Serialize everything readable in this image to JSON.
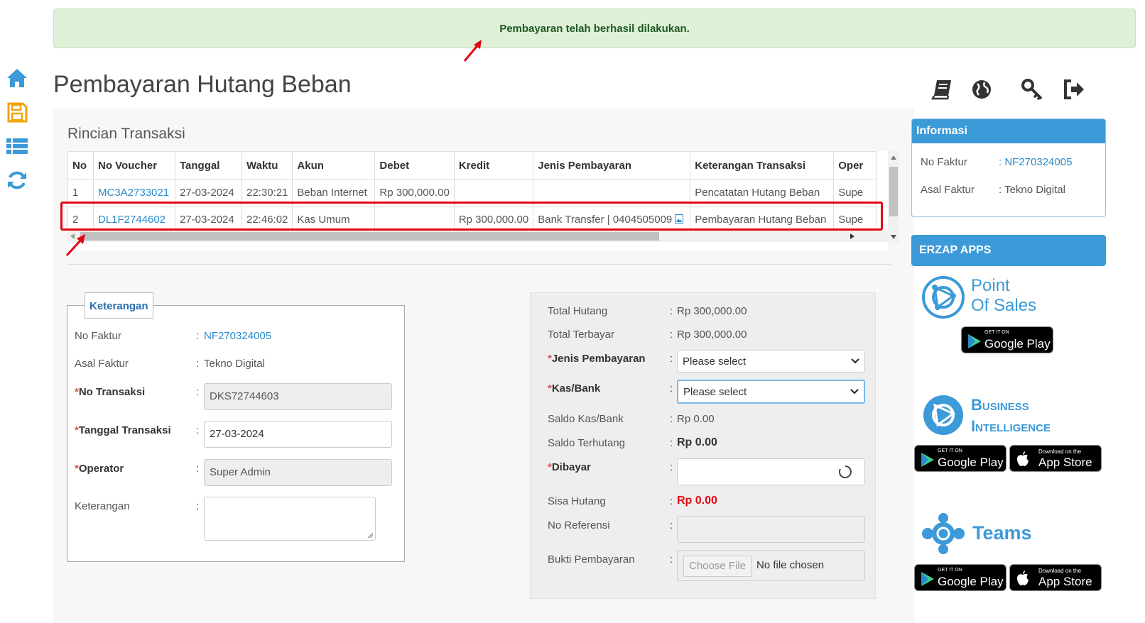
{
  "alert": {
    "message": "Pembayaran telah berhasil dilakukan."
  },
  "page": {
    "title": "Pembayaran Hutang Beban"
  },
  "section": {
    "title": "Rincian Transaksi"
  },
  "table": {
    "headers": [
      "No",
      "No Voucher",
      "Tanggal",
      "Waktu",
      "Akun",
      "Debet",
      "Kredit",
      "Jenis Pembayaran",
      "Keterangan Transaksi",
      "Oper"
    ],
    "rows": [
      {
        "no": "1",
        "voucher": "MC3A2733021",
        "tanggal": "27-03-2024",
        "waktu": "22:30:21",
        "akun": "Beban Internet",
        "debet": "Rp 300,000.00",
        "kredit": "",
        "jenis": "",
        "keterangan": "Pencatatan Hutang Beban",
        "operator": "Supe"
      },
      {
        "no": "2",
        "voucher": "DL1F2744602",
        "tanggal": "27-03-2024",
        "waktu": "22:46:02",
        "akun": "Kas Umum",
        "debet": "",
        "kredit": "Rp 300,000.00",
        "jenis": "Bank Transfer | 0404505009",
        "keterangan": "Pembayaran Hutang Beban",
        "operator": "Supe"
      }
    ]
  },
  "keterangan": {
    "legend": "Keterangan",
    "no_faktur_label": "No Faktur",
    "no_faktur_value": "NF270324005",
    "asal_faktur_label": "Asal Faktur",
    "asal_faktur_value": "Tekno Digital",
    "no_transaksi_label": "No Transaksi",
    "no_transaksi_value": "DKS72744603",
    "tanggal_label": "Tanggal Transaksi",
    "tanggal_value": "27-03-2024",
    "operator_label": "Operator",
    "operator_value": "Super Admin",
    "keterangan_label": "Keterangan",
    "colon": ":",
    "asterisk": "*"
  },
  "payment": {
    "total_hutang_label": "Total Hutang",
    "total_hutang_value": "Rp 300,000.00",
    "total_terbayar_label": "Total Terbayar",
    "total_terbayar_value": "Rp 300,000.00",
    "jenis_label": "Jenis Pembayaran",
    "jenis_value": "Please select",
    "kasbank_label": "Kas/Bank",
    "kasbank_value": "Please select",
    "saldo_kas_label": "Saldo Kas/Bank",
    "saldo_kas_value": "Rp 0.00",
    "saldo_terhutang_label": "Saldo Terhutang",
    "saldo_terhutang_value": "Rp 0.00",
    "dibayar_label": "Dibayar",
    "sisa_label": "Sisa Hutang",
    "sisa_value": "Rp 0.00",
    "no_ref_label": "No Referensi",
    "bukti_label": "Bukti Pembayaran",
    "choose_file": "Choose File",
    "no_file": "No file chosen",
    "colon": ":",
    "asterisk": "*"
  },
  "informasi": {
    "title": "Informasi",
    "no_faktur_label": "No Faktur",
    "no_faktur_value": ": NF270324005",
    "asal_faktur_label": "Asal Faktur",
    "asal_faktur_value": ": Tekno Digital"
  },
  "apps": {
    "title": "ERZAP APPS",
    "pos_line1": "Point",
    "pos_line2": "Of Sales",
    "bi_line1": "Business",
    "bi_line2": "Intelligence",
    "teams": "Teams",
    "gp_small": "GET IT ON",
    "gp_big": "Google Play",
    "as_small": "Download on the",
    "as_big": "App Store"
  },
  "colors": {
    "accent": "#3c9ad8",
    "success_bg": "#dff0d8",
    "highlight": "#e30613",
    "link": "#2a8acb"
  }
}
